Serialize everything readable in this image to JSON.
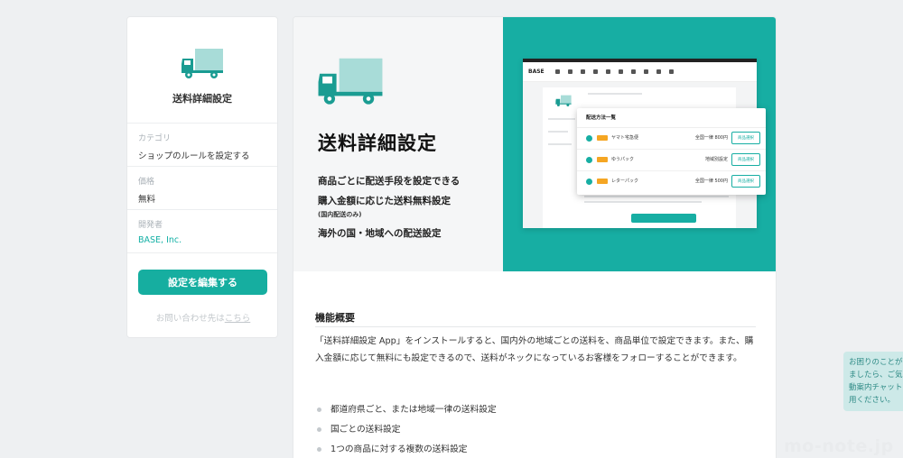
{
  "sidebar": {
    "app_title": "送料詳細設定",
    "category_label": "カテゴリ",
    "category_value": "ショップのルールを設定する",
    "price_label": "価格",
    "price_value": "無料",
    "developer_label": "開発者",
    "developer_value": "BASE, Inc.",
    "edit_button": "設定を編集する",
    "contact_text": "お問い合わせ先は",
    "contact_link": "こちら"
  },
  "hero": {
    "title": "送料詳細設定",
    "features": [
      "商品ごとに配送手段を設定できる",
      "購入金額に応じた送料無料設定",
      "海外の国・地域への配送設定"
    ],
    "note": "(国内配送のみ)"
  },
  "mockup": {
    "brand": "BASE",
    "popup_title": "配送方法一覧",
    "rows": [
      {
        "name": "ヤマト宅急便",
        "price": "全国一律 800円",
        "button": "商品選択"
      },
      {
        "name": "ゆうパック",
        "price": "地域別設定",
        "button": "商品選択"
      },
      {
        "name": "レターパック",
        "price": "全国一律 500円",
        "button": "商品選択"
      }
    ]
  },
  "description": {
    "heading": "機能概要",
    "body": "「送料詳細設定 App」をインストールすると、国内外の地域ごとの送料を、商品単位で設定できます。また、購入金額に応じて無料にも設定できるので、送料がネックになっているお客様をフォローすることができます。",
    "bullets": [
      "都道府県ごと、または地域一律の送料設定",
      "国ごとの送料設定",
      "1つの商品に対する複数の送料設定"
    ]
  },
  "chat": {
    "lines": [
      "お困りのことがあり",
      "ましたら、ご気軽に",
      "動案内チャットをご",
      "用ください。"
    ]
  },
  "watermark": "mo-note.jp",
  "colors": {
    "accent": "#16aea0",
    "background": "#eef0f2"
  }
}
